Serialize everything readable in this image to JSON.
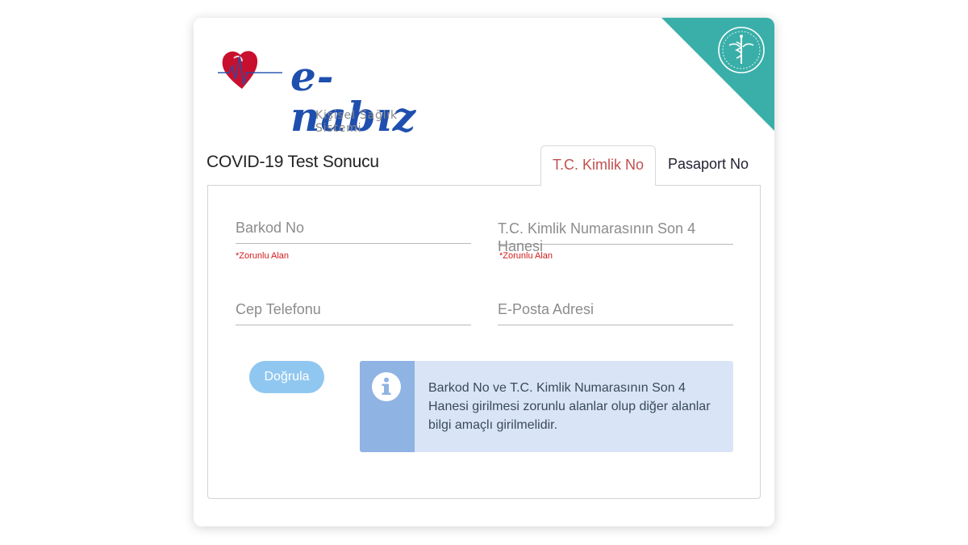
{
  "logo": {
    "brand": "e-nabız",
    "tagline": "Kişisel Sağlık Sistemi"
  },
  "page_title": "COVID-19 Test Sonucu",
  "tabs": [
    {
      "label": "T.C. Kimlik No",
      "active": true
    },
    {
      "label": "Pasaport No",
      "active": false
    }
  ],
  "form": {
    "barcode": {
      "placeholder": "Barkod No",
      "required_note": "*Zorunlu Alan"
    },
    "tc_last4": {
      "placeholder": "T.C. Kimlik Numarasının Son 4 Hanesi",
      "required_note": "*Zorunlu Alan"
    },
    "phone": {
      "placeholder": "Cep Telefonu"
    },
    "email": {
      "placeholder": "E-Posta Adresi"
    },
    "verify_label": "Doğrula"
  },
  "info_message": "Barkod No ve T.C. Kimlik Numarasının Son 4 Hanesi girilmesi zorunlu alanlar olup diğer alanlar bilgi amaçlı girilmelidir.",
  "colors": {
    "brand_blue": "#1f4fae",
    "teal_corner": "#3aafa9",
    "active_tab_text": "#c0504d",
    "required_red": "#d11a1a",
    "button_blue": "#90c7f0",
    "info_bg": "#d9e5f6",
    "info_accent": "#8fb3e3"
  },
  "icons": {
    "ministry_emblem": "ministry-emblem-icon",
    "info": "info-icon",
    "heart_logo": "heart-icon"
  }
}
